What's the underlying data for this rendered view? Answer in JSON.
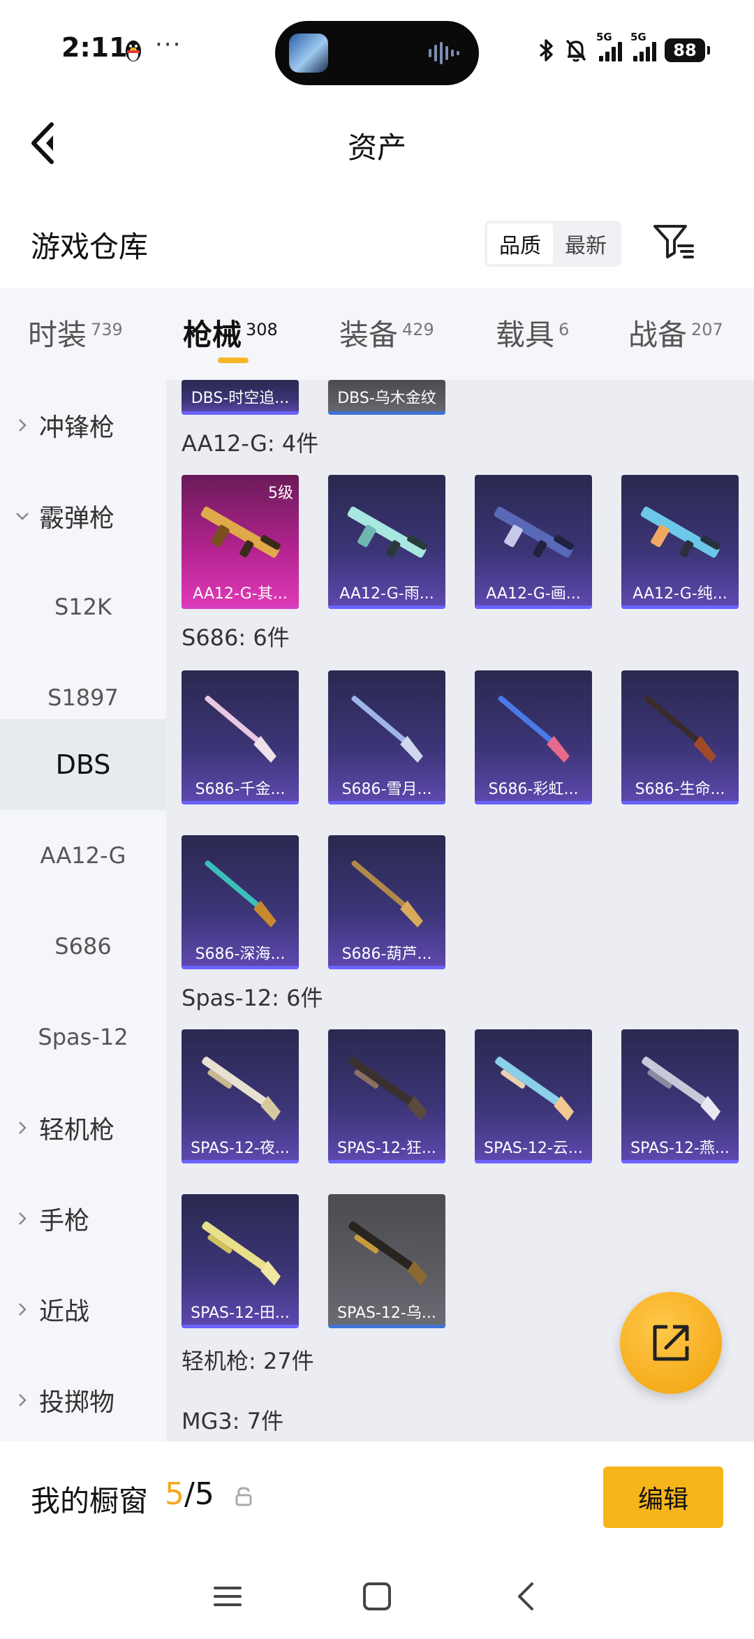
{
  "status": {
    "time": "2:11",
    "dots": "···",
    "signal1": "5G",
    "signal2": "5G",
    "battery": "88"
  },
  "header": {
    "title": "资产"
  },
  "warehouse": {
    "title": "游戏仓库",
    "sort_options": [
      "品质",
      "最新"
    ],
    "sort_selected": "品质"
  },
  "tabs": [
    {
      "label": "时装",
      "count": "739"
    },
    {
      "label": "枪械",
      "count": "308",
      "active": true
    },
    {
      "label": "装备",
      "count": "429"
    },
    {
      "label": "载具",
      "count": "6"
    },
    {
      "label": "战备",
      "count": "207"
    }
  ],
  "sidebar": {
    "items": [
      {
        "label": "冲锋枪",
        "kind": "group",
        "expanded": false
      },
      {
        "label": "霰弹枪",
        "kind": "group",
        "expanded": true
      },
      {
        "label": "S12K",
        "kind": "sub"
      },
      {
        "label": "S1897",
        "kind": "sub"
      },
      {
        "label": "DBS",
        "kind": "sub",
        "active": true
      },
      {
        "label": "AA12-G",
        "kind": "sub"
      },
      {
        "label": "S686",
        "kind": "sub"
      },
      {
        "label": "Spas-12",
        "kind": "sub"
      },
      {
        "label": "轻机枪",
        "kind": "group",
        "expanded": false
      },
      {
        "label": "手枪",
        "kind": "group",
        "expanded": false
      },
      {
        "label": "近战",
        "kind": "group",
        "expanded": false
      },
      {
        "label": "投掷物",
        "kind": "group",
        "expanded": false
      }
    ]
  },
  "content": {
    "partial_items": [
      "DBS-时空追...",
      "DBS-乌木金纹"
    ],
    "groups": [
      {
        "label": "AA12-G: 4件",
        "items": [
          {
            "name": "AA12-G-其...",
            "level": "5级"
          },
          {
            "name": "AA12-G-雨..."
          },
          {
            "name": "AA12-G-画..."
          },
          {
            "name": "AA12-G-纯..."
          }
        ]
      },
      {
        "label": "S686: 6件",
        "items": [
          {
            "name": "S686-千金..."
          },
          {
            "name": "S686-雪月..."
          },
          {
            "name": "S686-彩虹..."
          },
          {
            "name": "S686-生命..."
          },
          {
            "name": "S686-深海..."
          },
          {
            "name": "S686-葫芦..."
          }
        ]
      },
      {
        "label": "Spas-12: 6件",
        "items": [
          {
            "name": "SPAS-12-夜..."
          },
          {
            "name": "SPAS-12-狂..."
          },
          {
            "name": "SPAS-12-云..."
          },
          {
            "name": "SPAS-12-燕..."
          },
          {
            "name": "SPAS-12-田..."
          },
          {
            "name": "SPAS-12-乌..."
          }
        ]
      }
    ],
    "lmg_label": "轻机枪: 27件",
    "mg3_label": "MG3: 7件"
  },
  "showcase": {
    "label": "我的橱窗",
    "current": "5",
    "sep_total": "/5",
    "edit_label": "编辑"
  },
  "colors": {
    "accent": "#f7b51c",
    "card_purple": "#3c3577",
    "card_pink": "#b2238f",
    "card_gray": "#5c5c63"
  },
  "icons": {
    "back": "back-arrow-icon",
    "filter": "filter-icon",
    "share": "share-external-icon",
    "lock": "lock-icon"
  }
}
